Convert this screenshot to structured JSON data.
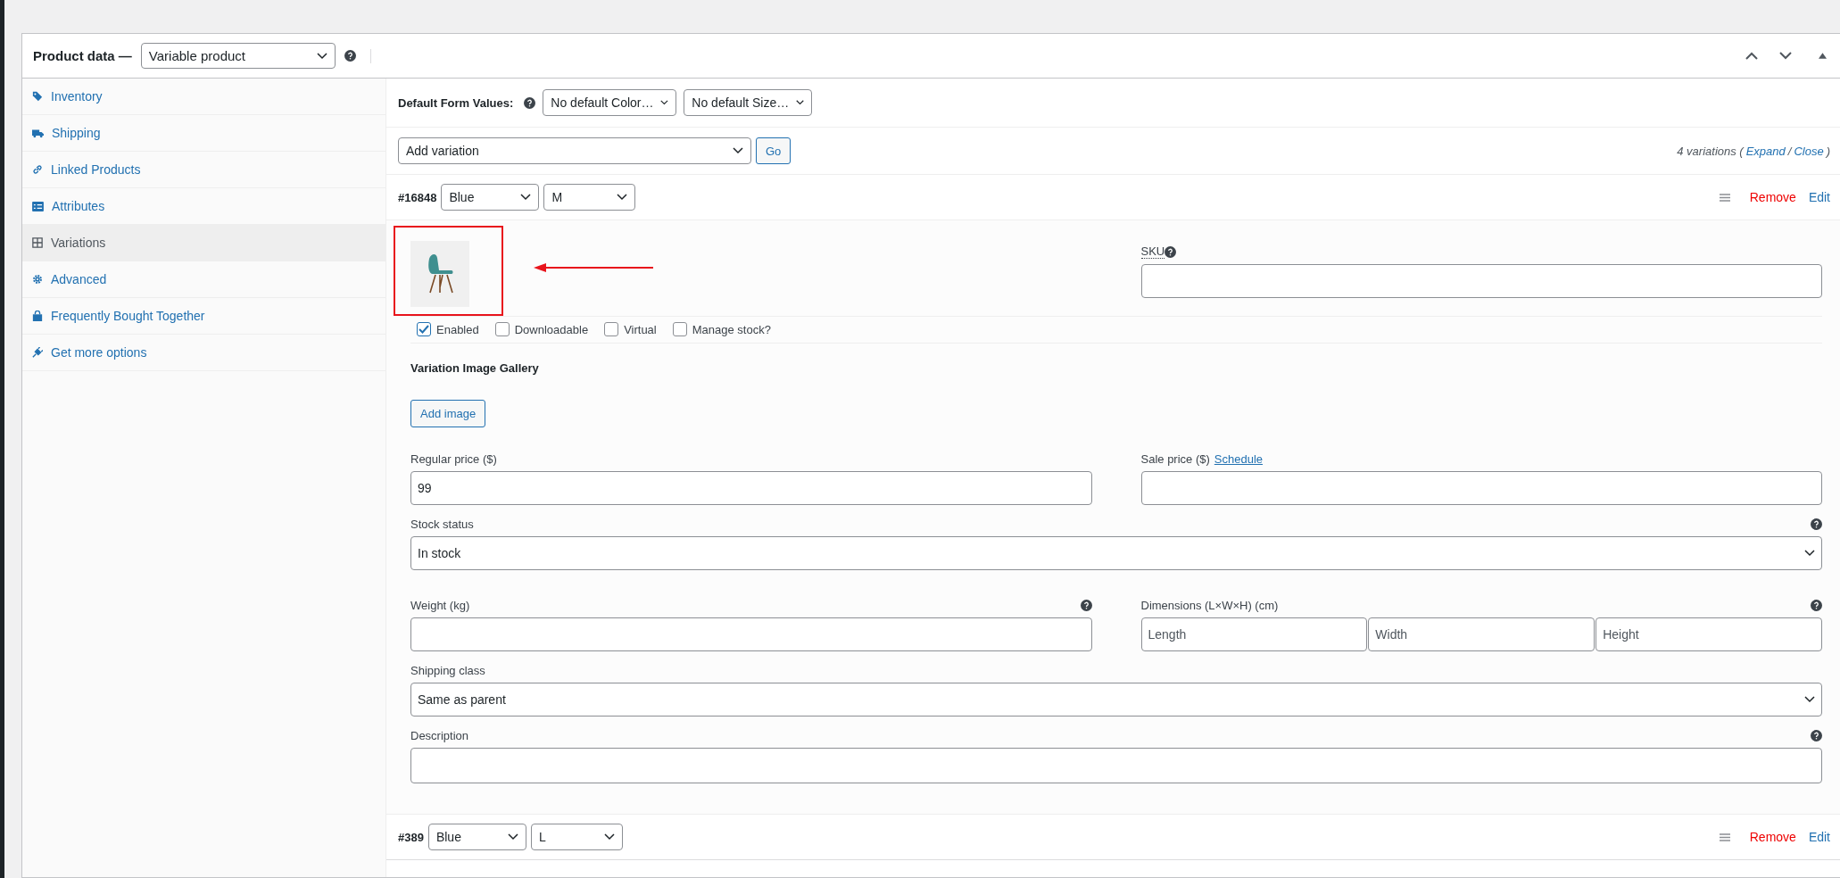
{
  "panel": {
    "title": "Product data —",
    "product_type": "Variable product"
  },
  "tabs": [
    {
      "label": "Inventory",
      "selected": false
    },
    {
      "label": "Shipping",
      "selected": false
    },
    {
      "label": "Linked Products",
      "selected": false
    },
    {
      "label": "Attributes",
      "selected": false
    },
    {
      "label": "Variations",
      "selected": true
    },
    {
      "label": "Advanced",
      "selected": false
    },
    {
      "label": "Frequently Bought Together",
      "selected": false
    },
    {
      "label": "Get more options",
      "selected": false
    }
  ],
  "defaults": {
    "label": "Default Form Values:",
    "selects": [
      "No default Color…",
      "No default Size…"
    ]
  },
  "add_variation": {
    "select": "Add variation",
    "button": "Go",
    "summary": [
      {
        "kind": "text",
        "text": "4 variations ("
      },
      {
        "kind": "link",
        "text": "Expand"
      },
      {
        "kind": "text",
        "text": "/"
      },
      {
        "kind": "link",
        "text": "Close"
      },
      {
        "kind": "text",
        "text": ")"
      }
    ]
  },
  "variations": [
    {
      "id": "#16848",
      "attributes": [
        "Blue",
        "M"
      ],
      "remove": "Remove",
      "edit": "Edit",
      "expanded": true,
      "details": {
        "sku_label": "SKU",
        "options": [
          {
            "label": "Enabled",
            "checked": true
          },
          {
            "label": "Downloadable",
            "checked": false
          },
          {
            "label": "Virtual",
            "checked": false
          },
          {
            "label": "Manage stock?",
            "checked": false
          }
        ],
        "gallery_title": "Variation Image Gallery",
        "add_image": "Add image",
        "regular_price_label": "Regular price ($)",
        "regular_price": "99",
        "sale_price_label": "Sale price ($)",
        "schedule": "Schedule",
        "stock_status_label": "Stock status",
        "stock_status": "In stock",
        "weight_label": "Weight (kg)",
        "dimensions_label": "Dimensions (L×W×H) (cm)",
        "dimension_placeholders": [
          "Length",
          "Width",
          "Height"
        ],
        "shipping_class_label": "Shipping class",
        "shipping_class": "Same as parent",
        "description_label": "Description"
      }
    },
    {
      "id": "#389",
      "attributes": [
        "Blue",
        "L"
      ],
      "remove": "Remove",
      "edit": "Edit",
      "expanded": false
    }
  ]
}
